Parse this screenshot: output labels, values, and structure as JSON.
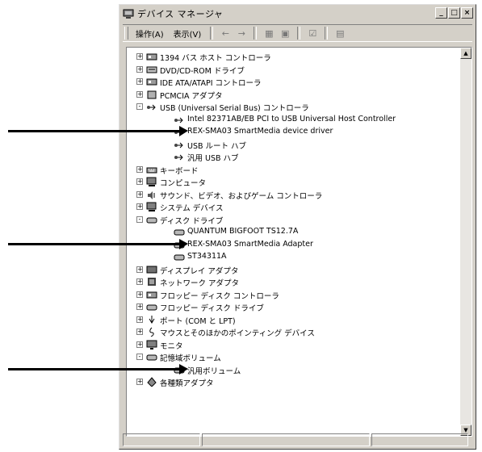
{
  "window": {
    "title": "デバイス マネージャ",
    "controls": [
      "_",
      "□",
      "×"
    ]
  },
  "toolbar": {
    "menus": [
      "操作(A)",
      "表示(V)"
    ],
    "buttons": [
      "←",
      "→",
      "▦",
      "▣",
      "☑",
      "▤"
    ]
  },
  "tree": [
    {
      "label": "1394 バス ホスト コントローラ",
      "level": 0,
      "expander": "+",
      "icon": "controller-icon"
    },
    {
      "label": "DVD/CD-ROM ドライブ",
      "level": 0,
      "expander": "+",
      "icon": "cdrom-icon"
    },
    {
      "label": "IDE ATA/ATAPI コントローラ",
      "level": 0,
      "expander": "+",
      "icon": "controller-icon"
    },
    {
      "label": "PCMCIA アダプタ",
      "level": 0,
      "expander": "+",
      "icon": "pcmcia-icon"
    },
    {
      "label": "USB (Universal Serial Bus) コントローラ",
      "level": 0,
      "expander": "-",
      "icon": "usb-icon"
    },
    {
      "label": "Intel 82371AB/EB PCI to USB Universal Host Controller",
      "level": 1,
      "expander": "",
      "icon": "usb-icon"
    },
    {
      "label": "REX-SMA03 SmartMedia device driver",
      "level": 1,
      "expander": "",
      "icon": "usb-icon"
    },
    {
      "label": "USB ルート ハブ",
      "level": 1,
      "expander": "",
      "icon": "usb-icon"
    },
    {
      "label": "汎用 USB ハブ",
      "level": 1,
      "expander": "",
      "icon": "usb-icon"
    },
    {
      "label": "キーボード",
      "level": 0,
      "expander": "+",
      "icon": "keyboard-icon"
    },
    {
      "label": "コンピュータ",
      "level": 0,
      "expander": "+",
      "icon": "computer-icon"
    },
    {
      "label": "サウンド、ビデオ、およびゲーム コントローラ",
      "level": 0,
      "expander": "+",
      "icon": "sound-icon"
    },
    {
      "label": "システム デバイス",
      "level": 0,
      "expander": "+",
      "icon": "computer-icon"
    },
    {
      "label": "ディスク ドライブ",
      "level": 0,
      "expander": "-",
      "icon": "disk-icon"
    },
    {
      "label": "QUANTUM BIGFOOT TS12.7A",
      "level": 1,
      "expander": "",
      "icon": "disk-icon"
    },
    {
      "label": "REX-SMA03 SmartMedia Adapter",
      "level": 1,
      "expander": "",
      "icon": "disk-icon"
    },
    {
      "label": "ST34311A",
      "level": 1,
      "expander": "",
      "icon": "disk-icon"
    },
    {
      "label": "ディスプレイ アダプタ",
      "level": 0,
      "expander": "+",
      "icon": "display-icon"
    },
    {
      "label": "ネットワーク アダプタ",
      "level": 0,
      "expander": "+",
      "icon": "network-icon"
    },
    {
      "label": "フロッピー ディスク コントローラ",
      "level": 0,
      "expander": "+",
      "icon": "controller-icon"
    },
    {
      "label": "フロッピー ディスク ドライブ",
      "level": 0,
      "expander": "+",
      "icon": "disk-icon"
    },
    {
      "label": "ポート (COM と LPT)",
      "level": 0,
      "expander": "+",
      "icon": "port-icon"
    },
    {
      "label": "マウスとそのほかのポインティング デバイス",
      "level": 0,
      "expander": "+",
      "icon": "mouse-icon"
    },
    {
      "label": "モニタ",
      "level": 0,
      "expander": "+",
      "icon": "monitor-icon"
    },
    {
      "label": "記憶域ボリューム",
      "level": 0,
      "expander": "-",
      "icon": "disk-icon"
    },
    {
      "label": "汎用ボリューム",
      "level": 1,
      "expander": "",
      "icon": "disk-icon"
    },
    {
      "label": "各種類アダプタ",
      "level": 0,
      "expander": "+",
      "icon": "adapter-icon"
    }
  ],
  "annotations": {
    "arrow_rows": [
      6,
      15,
      25
    ]
  }
}
